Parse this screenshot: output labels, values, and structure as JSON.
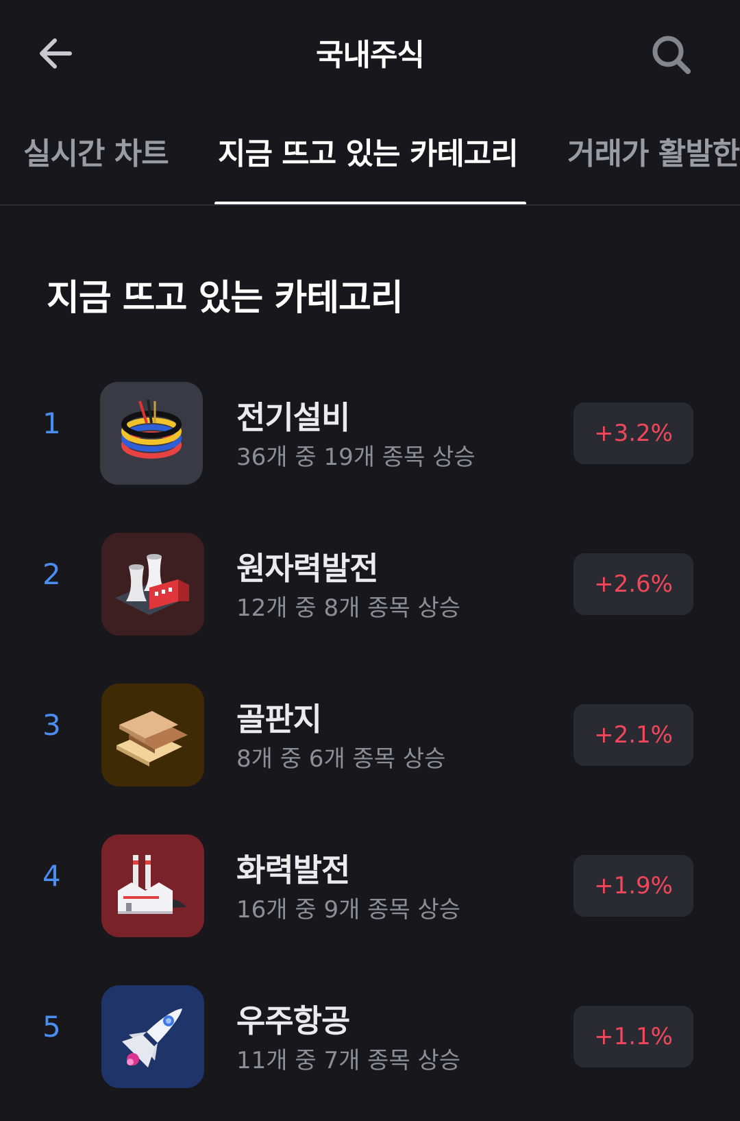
{
  "header": {
    "title": "국내주식",
    "back_icon": "arrow-left-icon",
    "search_icon": "search-icon"
  },
  "tabs": [
    {
      "label": "실시간 차트",
      "active": false
    },
    {
      "label": "지금 뜨고 있는 카테고리",
      "active": true
    },
    {
      "label": "거래가 활발한",
      "active": false
    }
  ],
  "section": {
    "title": "지금 뜨고 있는 카테고리"
  },
  "categories": [
    {
      "rank": "1",
      "name": "전기설비",
      "summary": "36개 중 19개 종목 상승",
      "change": "+3.2%",
      "icon": "electric-cable-icon",
      "tile_color": "#3a3a44"
    },
    {
      "rank": "2",
      "name": "원자력발전",
      "summary": "12개 중 8개 종목 상승",
      "change": "+2.6%",
      "icon": "nuclear-plant-icon",
      "tile_color": "#3d1f22"
    },
    {
      "rank": "3",
      "name": "골판지",
      "summary": "8개 중 6개 종목 상승",
      "change": "+2.1%",
      "icon": "cardboard-icon",
      "tile_color": "#3f2a06"
    },
    {
      "rank": "4",
      "name": "화력발전",
      "summary": "16개 중 9개 종목 상승",
      "change": "+1.9%",
      "icon": "thermal-plant-icon",
      "tile_color": "#7a2229"
    },
    {
      "rank": "5",
      "name": "우주항공",
      "summary": "11개 중 7개 종목 상승",
      "change": "+1.1%",
      "icon": "rocket-icon",
      "tile_color": "#1f3468"
    }
  ],
  "colors": {
    "background": "#17171c",
    "rank": "#4a8ef2",
    "rise": "#f0485a",
    "badge_bg": "#2a2a33"
  }
}
